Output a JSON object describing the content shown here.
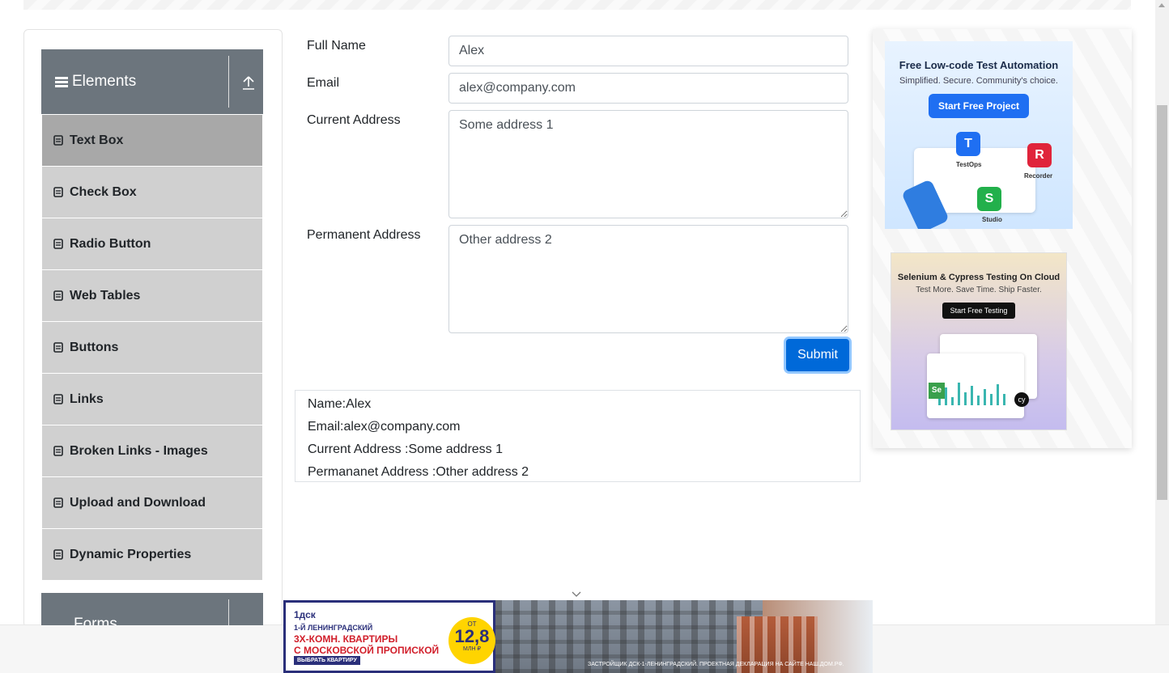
{
  "sidebar": {
    "group_title": "Elements",
    "items": [
      {
        "label": "Text Box",
        "active": true
      },
      {
        "label": "Check Box"
      },
      {
        "label": "Radio Button"
      },
      {
        "label": "Web Tables"
      },
      {
        "label": "Buttons"
      },
      {
        "label": "Links"
      },
      {
        "label": "Broken Links - Images"
      },
      {
        "label": "Upload and Download"
      },
      {
        "label": "Dynamic Properties"
      }
    ],
    "next_group_title": "Forms"
  },
  "form": {
    "full_name_label": "Full Name",
    "full_name_value": "Alex",
    "email_label": "Email",
    "email_value": "alex@company.com",
    "current_address_label": "Current Address",
    "current_address_value": "Some address 1",
    "permanent_address_label": "Permanent Address",
    "permanent_address_value": "Other address 2",
    "submit_label": "Submit"
  },
  "output": {
    "name": "Name:Alex",
    "email": "Email:alex@company.com",
    "current_address": "Current Address :Some address 1",
    "permanent_address": "Permananet Address :Other address 2"
  },
  "ads": {
    "ad1": {
      "headline": "Free Low-code Test Automation",
      "subtext": "Simplified. Secure. Community's choice.",
      "button": "Start Free Project",
      "labels": [
        "TestOps",
        "Recorder",
        "Studio"
      ]
    },
    "ad2": {
      "headline": "Selenium & Cypress Testing On Cloud",
      "subtext": "Test More. Save Time. Ship Faster.",
      "button": "Start Free Testing"
    },
    "banner": {
      "brand": "1дск",
      "sub": "1-Й ЛЕНИНГРАДСКИЙ",
      "headline_1": "3Х-КОМН. КВАРТИРЫ",
      "headline_2": "С МОСКОВСКОЙ ПРОПИСКОЙ",
      "cta": "ВЫБРАТЬ КВАРТИРУ",
      "price_prefix": "ОТ",
      "price": "12,8",
      "price_unit": "МЛН ₽",
      "disclaimer": "ЗАСТРОЙЩИК ДСК-1-ЛЕНИНГРАДСКИЙ. ПРОЕКТНАЯ ДЕКЛАРАЦИЯ НА САЙТЕ НАШ.ДОМ.РФ."
    }
  },
  "colors": {
    "sidebar_header": "#6c757d",
    "menu_item": "#d0d0d0",
    "menu_item_active": "#a8a8a8",
    "submit": "#0069d9"
  }
}
